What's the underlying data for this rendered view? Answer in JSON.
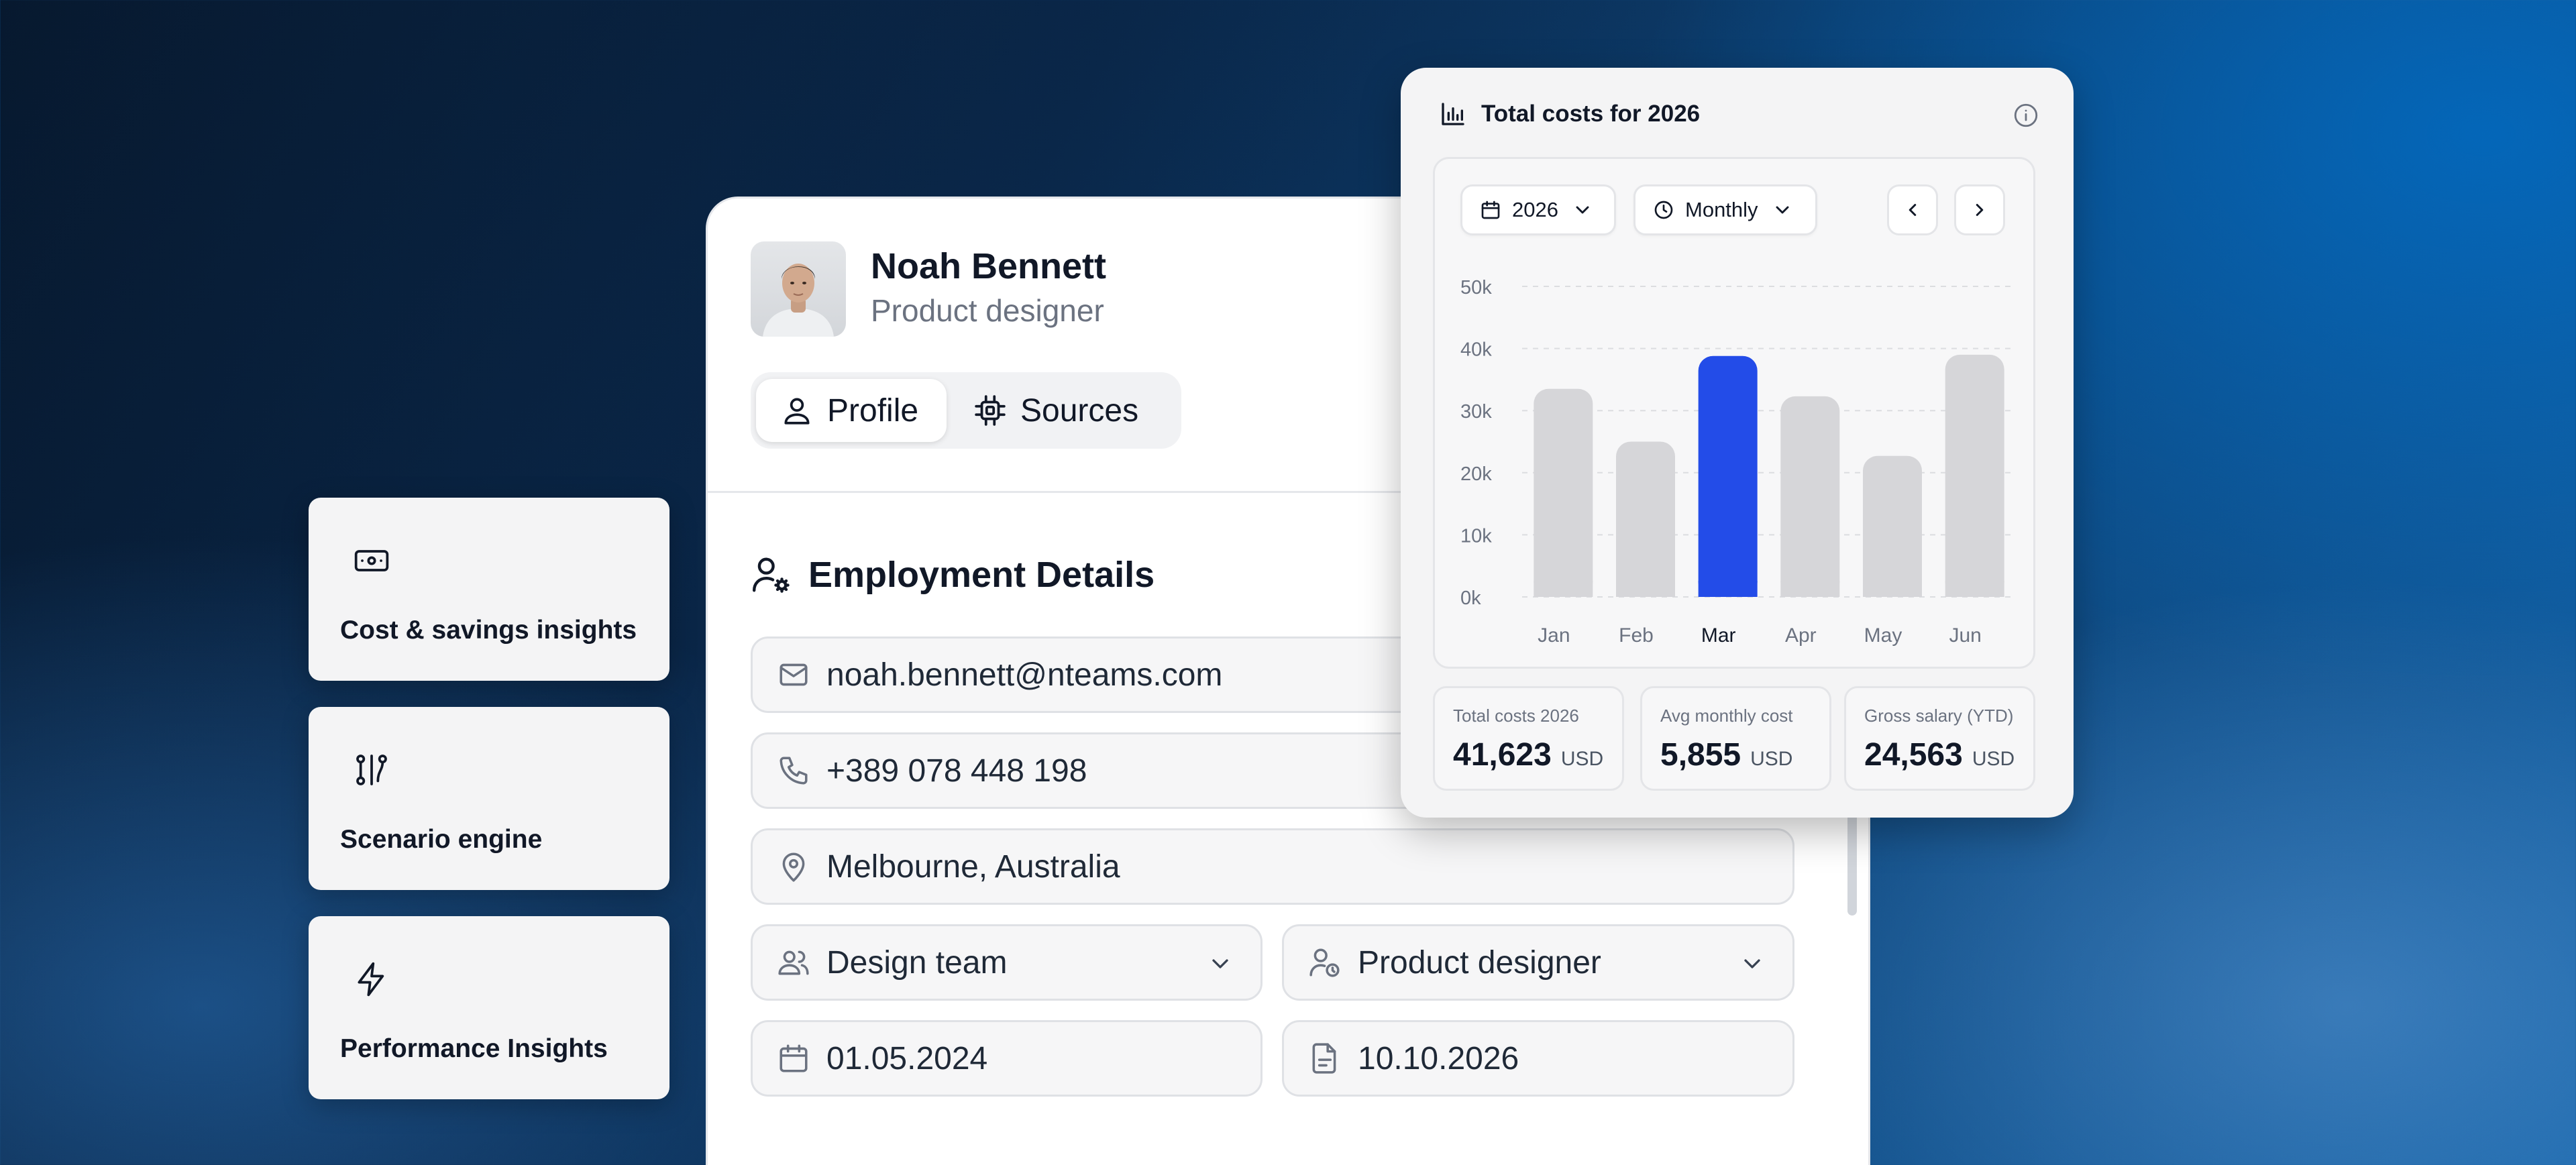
{
  "features": [
    {
      "label": "Cost & savings insights",
      "icon": "banknote-icon"
    },
    {
      "label": "Scenario engine",
      "icon": "route-icon"
    },
    {
      "label": "Performance Insights",
      "icon": "zap-icon"
    }
  ],
  "profile": {
    "name": "Noah Bennett",
    "role": "Product designer",
    "tabs": [
      {
        "label": "Profile",
        "icon": "user-icon",
        "active": true
      },
      {
        "label": "Sources",
        "icon": "chip-icon",
        "active": false
      }
    ],
    "section_title": "Employment Details",
    "fields": {
      "email": "noah.bennett@nteams.com",
      "phone": "+389 078 448 198",
      "location": "Melbourne, Australia",
      "team": "Design team",
      "position": "Product designer",
      "start_date": "01.05.2024",
      "end_date": "10.10.2026"
    }
  },
  "costs": {
    "title": "Total costs for 2026",
    "year_select": "2026",
    "period_select": "Monthly",
    "stats": [
      {
        "label": "Total costs 2026",
        "value": "41,623",
        "unit": "USD"
      },
      {
        "label": "Avg monthly cost",
        "value": "5,855",
        "unit": "USD"
      },
      {
        "label": "Gross salary (YTD)",
        "value": "24,563",
        "unit": "USD"
      }
    ]
  },
  "chart_data": {
    "type": "bar",
    "categories": [
      "Jan",
      "Feb",
      "Mar",
      "Apr",
      "May",
      "Jun"
    ],
    "values": [
      33500,
      25000,
      38800,
      32300,
      22700,
      39000
    ],
    "highlight": "Mar",
    "highlight_color": "#234ce8",
    "bar_color": "#d6d6d9",
    "yticks": [
      "0k",
      "10k",
      "20k",
      "30k",
      "40k",
      "50k"
    ],
    "ylim": [
      0,
      50000
    ],
    "grid": true
  },
  "colors": {
    "accent": "#234ce8"
  }
}
